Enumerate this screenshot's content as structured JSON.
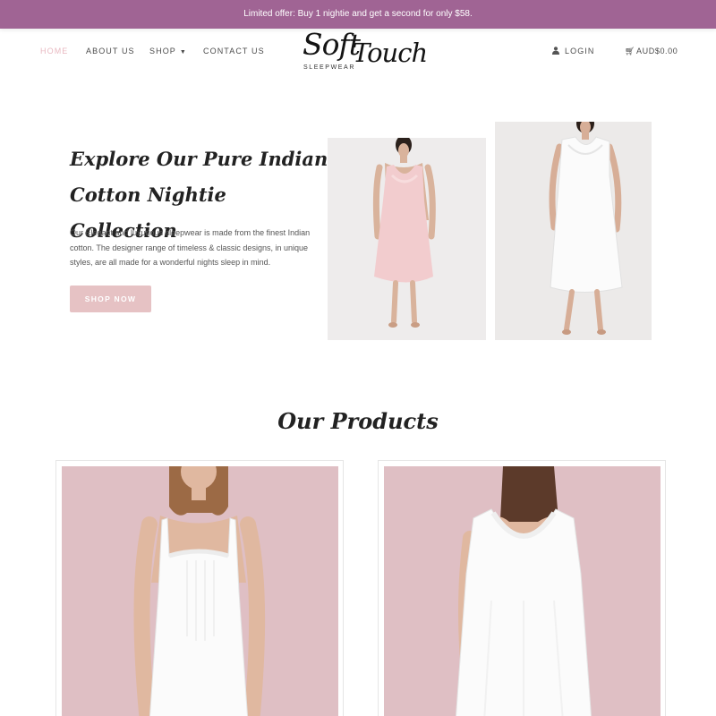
{
  "announcement": "Limited offer: Buy 1 nightie and get a second for only $58.",
  "nav": {
    "home": "HOME",
    "about": "ABOUT US",
    "shop": "SHOP",
    "contact": "CONTACT US",
    "login": "LOGIN",
    "cart": "AUD$0.00"
  },
  "logo": {
    "soft": "Soft",
    "touch": "Touch",
    "sub": "SLEEPWEAR"
  },
  "hero": {
    "title": "Explore Our Pure Indian Cotton Nightie Collection",
    "description": "Our Elegant and luxurious sleepwear is made from the finest Indian cotton. The designer range of timeless & classic designs, in unique styles, are all made for a wonderful nights sleep in mind.",
    "button": "SHOP NOW"
  },
  "products": {
    "title": "Our Products"
  },
  "colors": {
    "announcement_bg": "#a06494",
    "nav_active": "#e8b8c0",
    "button_bg": "#e6c2c4",
    "product_bg": "#dfbfc4"
  },
  "icons": {
    "login": "user-icon",
    "cart": "cart-icon",
    "shop_dropdown": "caret-down-icon"
  }
}
